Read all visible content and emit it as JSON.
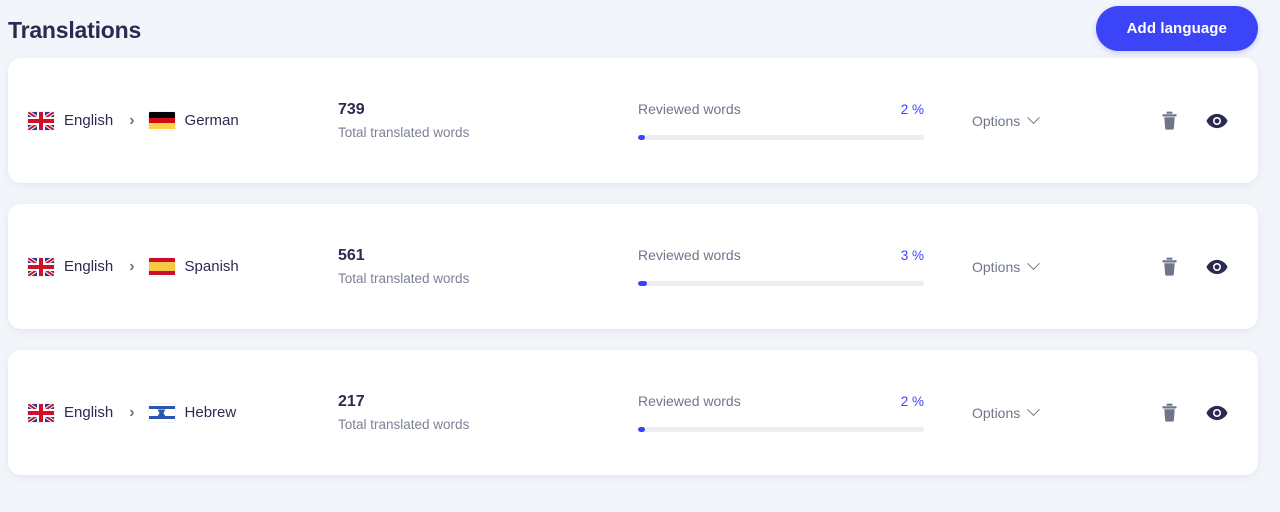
{
  "header": {
    "title": "Translations",
    "add_language_label": "Add language"
  },
  "labels": {
    "total_words_label": "Total translated words",
    "reviewed_label": "Reviewed words",
    "options_label": "Options",
    "pair_arrow": "›",
    "delete_icon": "trash-icon",
    "preview_icon": "eye-icon",
    "dropdown_icon": "chevron-down-icon"
  },
  "colors": {
    "accent": "#3b44f6",
    "title": "#2b2b52",
    "muted": "#7c8296",
    "background": "#f2f5fa",
    "card": "#ffffff",
    "track": "#eceef3"
  },
  "rows": [
    {
      "source_language": "English",
      "source_flag": "flag-uk",
      "target_language": "German",
      "target_flag": "flag-de",
      "total_words": "739",
      "total_words_label": "Total translated words",
      "reviewed_label": "Reviewed words",
      "reviewed_percent": "2 %",
      "reviewed_value": 2,
      "options_label": "Options"
    },
    {
      "source_language": "English",
      "source_flag": "flag-uk",
      "target_language": "Spanish",
      "target_flag": "flag-es",
      "total_words": "561",
      "total_words_label": "Total translated words",
      "reviewed_label": "Reviewed words",
      "reviewed_percent": "3 %",
      "reviewed_value": 3,
      "options_label": "Options"
    },
    {
      "source_language": "English",
      "source_flag": "flag-uk",
      "target_language": "Hebrew",
      "target_flag": "flag-il",
      "total_words": "217",
      "total_words_label": "Total translated words",
      "reviewed_label": "Reviewed words",
      "reviewed_percent": "2 %",
      "reviewed_value": 2,
      "options_label": "Options"
    }
  ]
}
